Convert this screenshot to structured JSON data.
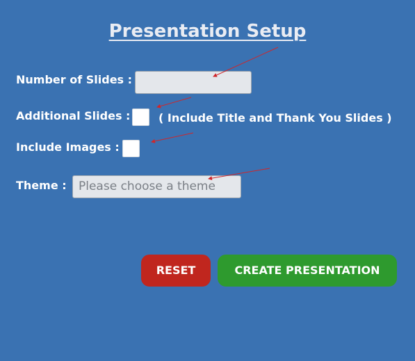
{
  "page": {
    "title": "Presentation Setup"
  },
  "form": {
    "slides_label": "Number of Slides :",
    "slides_value": "",
    "additional_label": "Additional Slides :",
    "additional_hint": "( Include Title and Thank You Slides )",
    "images_label": "Include Images :",
    "theme_label": "Theme :",
    "theme_placeholder": "Please choose a theme"
  },
  "buttons": {
    "reset": "RESET",
    "create": "CREATE PRESENTATION"
  },
  "colors": {
    "background": "#3a72b2",
    "reset": "#c0261e",
    "create": "#2e9a2e",
    "annotation_arrow": "#d0262a"
  }
}
